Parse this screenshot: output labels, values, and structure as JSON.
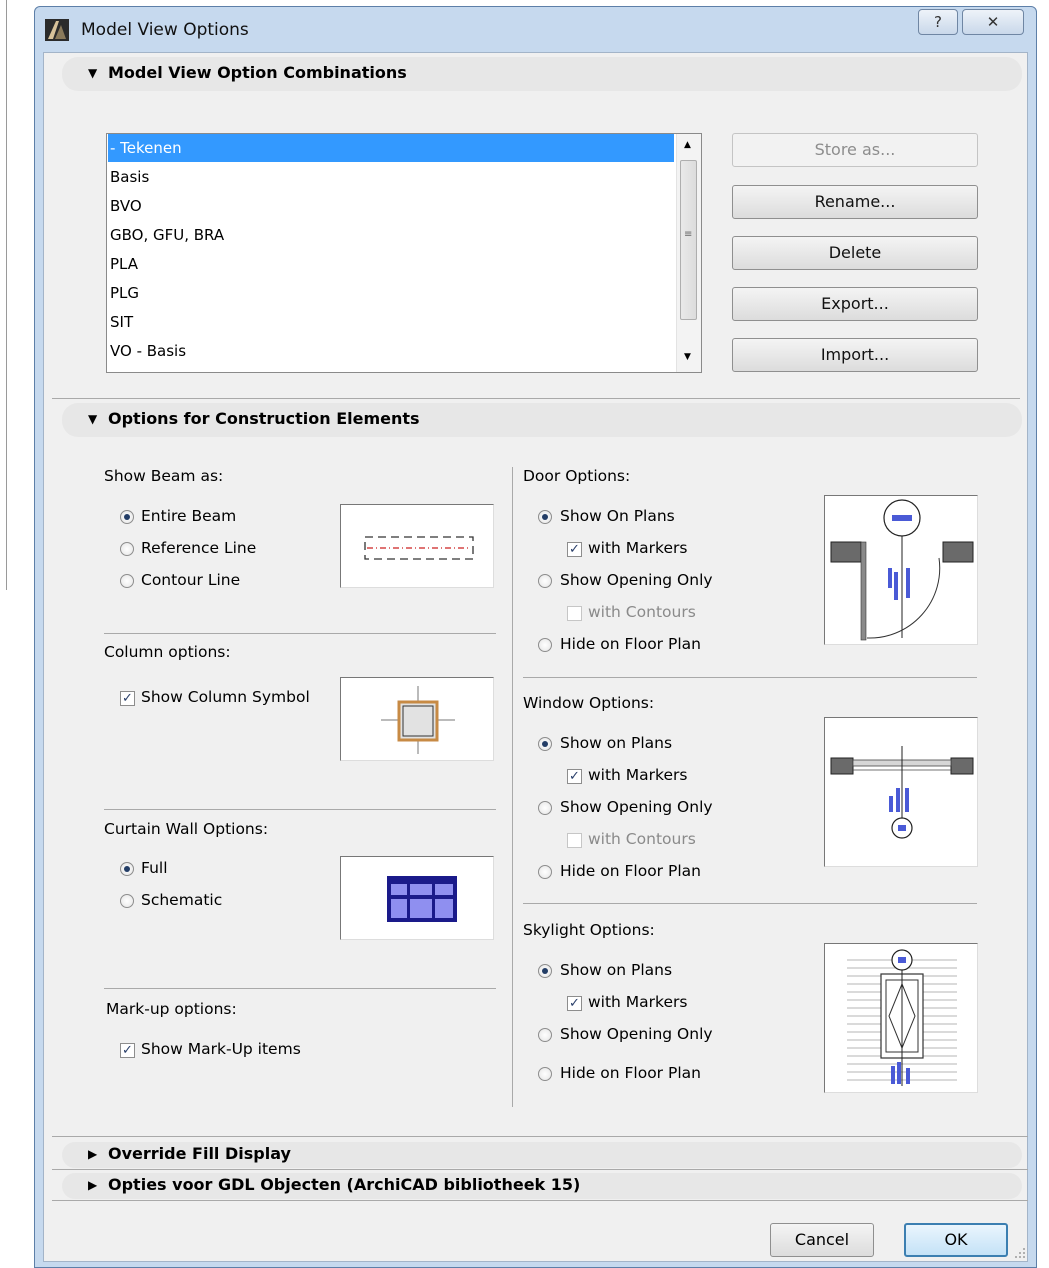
{
  "window": {
    "title": "Model View Options",
    "help_glyph": "?",
    "close_glyph": "✕"
  },
  "sections": {
    "combinations": "Model View Option Combinations",
    "construction": "Options for Construction Elements",
    "override": "Override Fill Display",
    "gdl": "Opties voor GDL Objecten (ArchiCAD bibliotheek 15)"
  },
  "combinations_list": {
    "items": [
      "- Tekenen",
      "Basis",
      "BVO",
      "GBO, GFU, BRA",
      "PLA",
      "PLG",
      "SIT",
      "VO - Basis"
    ],
    "selected": "- Tekenen"
  },
  "combination_buttons": {
    "store": "Store as...",
    "rename": "Rename...",
    "delete": "Delete",
    "export": "Export...",
    "import": "Import..."
  },
  "beam": {
    "label": "Show Beam as:",
    "entire": "Entire Beam",
    "reference": "Reference Line",
    "contour": "Contour Line",
    "selected": "Entire Beam"
  },
  "column": {
    "label": "Column options:",
    "symbol": "Show Column Symbol",
    "symbol_checked": true
  },
  "curtain": {
    "label": "Curtain Wall Options:",
    "full": "Full",
    "schematic": "Schematic",
    "selected": "Full"
  },
  "markup": {
    "label": "Mark-up options:",
    "show": "Show Mark-Up items",
    "show_checked": true
  },
  "door": {
    "label": "Door Options:",
    "on_plans": "Show On Plans",
    "markers": "with Markers",
    "opening": "Show Opening Only",
    "contours": "with Contours",
    "hide": "Hide on Floor Plan",
    "selected": "Show On Plans"
  },
  "window_opts": {
    "label": "Window Options:",
    "on_plans": "Show on Plans",
    "markers": "with Markers",
    "opening": "Show Opening Only",
    "contours": "with Contours",
    "hide": "Hide on Floor Plan",
    "selected": "Show on Plans"
  },
  "skylight": {
    "label": "Skylight Options:",
    "on_plans": "Show on Plans",
    "markers": "with Markers",
    "opening": "Show Opening Only",
    "hide": "Hide on Floor Plan",
    "selected": "Show on Plans"
  },
  "check_glyph": "✓",
  "arrows": {
    "expanded": "▼",
    "collapsed": "▶",
    "up": "▲",
    "down": "▼",
    "grip": "≡"
  },
  "footer": {
    "cancel": "Cancel",
    "ok": "OK"
  },
  "colors": {
    "selection": "#3399ff",
    "frame": "#c6d9ee",
    "panel": "#f0f0f0",
    "ok_border": "#3c7fb1"
  }
}
